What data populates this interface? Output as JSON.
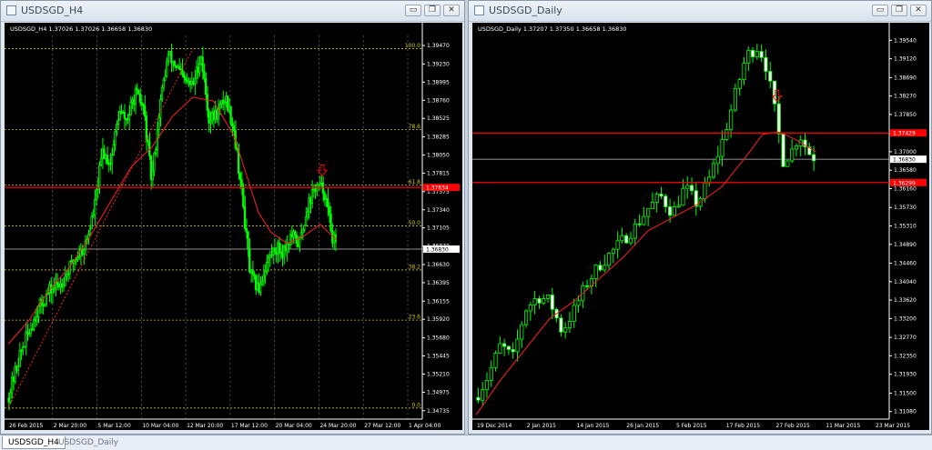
{
  "windows": [
    {
      "title": "USDSGD_H4",
      "buttons": [
        "minimize",
        "restore",
        "close"
      ]
    },
    {
      "title": "USDSGD_Daily",
      "buttons": [
        "minimize",
        "restore",
        "close"
      ]
    }
  ],
  "tabs": [
    "USDSGD_H4",
    "USDSGD_Daily"
  ],
  "icons": {
    "signal_arrow": "down-arrow-icon",
    "window": "window-icon"
  },
  "colors": {
    "background": "#000000",
    "grid": "#7a7a7a",
    "candle": "#00ff00",
    "ma": "#ff2020",
    "hline_red": "#ff0000",
    "fib": "#d0c800",
    "price_line": "#c0c0c0",
    "axis_text": "#ffffff"
  },
  "chart_data": [
    {
      "type": "candlestick",
      "title": "USDSGD_H4  1.37026 1.37026 1.36658 1.36830",
      "ylim": [
        1.3465,
        1.396
      ],
      "yticks": [
        "1.39470",
        "1.39230",
        "1.38995",
        "1.38760",
        "1.38525",
        "1.38285",
        "1.38050",
        "1.37815",
        "1.37575",
        "1.37340",
        "1.37105",
        "1.36870",
        "1.36630",
        "1.36395",
        "1.36155",
        "1.35920",
        "1.35680",
        "1.35445",
        "1.35210",
        "1.34975",
        "1.34735"
      ],
      "xticks": [
        "26 Feb 2015",
        "2 Mar 20:00",
        "5 Mar 12:00",
        "10 Mar 04:00",
        "12 Mar 20:00",
        "17 Mar 12:00",
        "20 Mar 04:00",
        "24 Mar 20:00",
        "27 Mar 12:00",
        "1 Apr 04:00"
      ],
      "fib_levels": [
        {
          "label": "100.0",
          "price": 1.3943
        },
        {
          "label": "78.6",
          "price": 1.3838
        },
        {
          "label": "61.8",
          "price": 1.3766
        },
        {
          "label": "50.0",
          "price": 1.3713
        },
        {
          "label": "38.2",
          "price": 1.3656
        },
        {
          "label": "23.6",
          "price": 1.3591
        },
        {
          "label": "0.0",
          "price": 1.3477
        }
      ],
      "red_line": {
        "price": 1.3763,
        "label": "1.37634"
      },
      "current_price": {
        "price": 1.3683,
        "label": "1.36830"
      },
      "grid": true,
      "signal_arrow": {
        "direction": "down",
        "price": 1.3784,
        "at_x_fraction": 0.765
      },
      "price_path": [
        [
          0,
          1.349
        ],
        [
          0.03,
          1.3548
        ],
        [
          0.07,
          1.3602
        ],
        [
          0.1,
          1.3628
        ],
        [
          0.13,
          1.364
        ],
        [
          0.16,
          1.3668
        ],
        [
          0.19,
          1.369
        ],
        [
          0.21,
          1.3735
        ],
        [
          0.23,
          1.381
        ],
        [
          0.25,
          1.3795
        ],
        [
          0.27,
          1.386
        ],
        [
          0.29,
          1.385
        ],
        [
          0.31,
          1.3885
        ],
        [
          0.33,
          1.3866
        ],
        [
          0.35,
          1.377
        ],
        [
          0.37,
          1.387
        ],
        [
          0.39,
          1.3935
        ],
        [
          0.41,
          1.392
        ],
        [
          0.43,
          1.39
        ],
        [
          0.45,
          1.3895
        ],
        [
          0.47,
          1.3935
        ],
        [
          0.49,
          1.385
        ],
        [
          0.51,
          1.386
        ],
        [
          0.53,
          1.388
        ],
        [
          0.55,
          1.384
        ],
        [
          0.57,
          1.3755
        ],
        [
          0.59,
          1.365
        ],
        [
          0.61,
          1.363
        ],
        [
          0.63,
          1.3665
        ],
        [
          0.65,
          1.3685
        ],
        [
          0.67,
          1.368
        ],
        [
          0.69,
          1.37
        ],
        [
          0.71,
          1.369
        ],
        [
          0.73,
          1.374
        ],
        [
          0.75,
          1.3765
        ],
        [
          0.77,
          1.376
        ],
        [
          0.79,
          1.37
        ],
        [
          0.8,
          1.3683
        ]
      ],
      "ma_path": [
        [
          0,
          1.356
        ],
        [
          0.05,
          1.359
        ],
        [
          0.1,
          1.363
        ],
        [
          0.15,
          1.366
        ],
        [
          0.2,
          1.37
        ],
        [
          0.25,
          1.3745
        ],
        [
          0.3,
          1.379
        ],
        [
          0.35,
          1.3815
        ],
        [
          0.4,
          1.3855
        ],
        [
          0.45,
          1.388
        ],
        [
          0.5,
          1.3875
        ],
        [
          0.55,
          1.383
        ],
        [
          0.58,
          1.378
        ],
        [
          0.61,
          1.373
        ],
        [
          0.64,
          1.3705
        ],
        [
          0.68,
          1.369
        ],
        [
          0.72,
          1.37
        ],
        [
          0.76,
          1.3715
        ],
        [
          0.8,
          1.3695
        ]
      ],
      "trend_line": [
        [
          0,
          1.3477
        ],
        [
          0.45,
          1.3943
        ]
      ]
    },
    {
      "type": "candlestick",
      "title": "USDSGD_Daily  1.37207 1.37350 1.36658 1.36830",
      "ylim": [
        1.3095,
        1.3965
      ],
      "yticks": [
        "1.39540",
        "1.39120",
        "1.38690",
        "1.38270",
        "1.37850",
        "1.37420",
        "1.37000",
        "1.36580",
        "1.36160",
        "1.35730",
        "1.35310",
        "1.34890",
        "1.34460",
        "1.34040",
        "1.33620",
        "1.33200",
        "1.32770",
        "1.32350",
        "1.31930",
        "1.31500",
        "1.31080"
      ],
      "xticks": [
        "19 Dec 2014",
        "2 Jan 2015",
        "14 Jan 2015",
        "26 Jan 2015",
        "5 Feb 2015",
        "17 Feb 2015",
        "27 Feb 2015",
        "11 Mar 2015",
        "23 Mar 2015"
      ],
      "red_lines": [
        {
          "price": 1.37429,
          "label": "1.37429"
        },
        {
          "price": 1.36299,
          "label": "1.36299"
        }
      ],
      "current_price": {
        "price": 1.3683,
        "label": "1.36830"
      },
      "grid": false,
      "signal_arrow": {
        "direction": "down",
        "price": 1.3825,
        "at_x_fraction": 0.735
      },
      "price_path": [
        [
          0,
          1.314
        ],
        [
          0.03,
          1.319
        ],
        [
          0.06,
          1.326
        ],
        [
          0.09,
          1.323
        ],
        [
          0.12,
          1.334
        ],
        [
          0.15,
          1.337
        ],
        [
          0.18,
          1.336
        ],
        [
          0.21,
          1.329
        ],
        [
          0.24,
          1.334
        ],
        [
          0.27,
          1.34
        ],
        [
          0.3,
          1.344
        ],
        [
          0.33,
          1.347
        ],
        [
          0.36,
          1.35
        ],
        [
          0.39,
          1.353
        ],
        [
          0.42,
          1.357
        ],
        [
          0.45,
          1.36
        ],
        [
          0.48,
          1.356
        ],
        [
          0.51,
          1.362
        ],
        [
          0.54,
          1.358
        ],
        [
          0.57,
          1.364
        ],
        [
          0.6,
          1.372
        ],
        [
          0.63,
          1.382
        ],
        [
          0.66,
          1.392
        ],
        [
          0.69,
          1.394
        ],
        [
          0.71,
          1.389
        ],
        [
          0.73,
          1.379
        ],
        [
          0.75,
          1.368
        ],
        [
          0.77,
          1.37
        ],
        [
          0.79,
          1.374
        ],
        [
          0.81,
          1.37
        ],
        [
          0.83,
          1.3683
        ]
      ],
      "ma_path": [
        [
          0,
          1.31
        ],
        [
          0.06,
          1.318
        ],
        [
          0.12,
          1.325
        ],
        [
          0.18,
          1.332
        ],
        [
          0.24,
          1.336
        ],
        [
          0.3,
          1.341
        ],
        [
          0.36,
          1.346
        ],
        [
          0.42,
          1.352
        ],
        [
          0.48,
          1.355
        ],
        [
          0.54,
          1.358
        ],
        [
          0.6,
          1.362
        ],
        [
          0.66,
          1.369
        ],
        [
          0.7,
          1.374
        ],
        [
          0.74,
          1.3745
        ],
        [
          0.78,
          1.3728
        ],
        [
          0.83,
          1.37
        ]
      ]
    }
  ]
}
